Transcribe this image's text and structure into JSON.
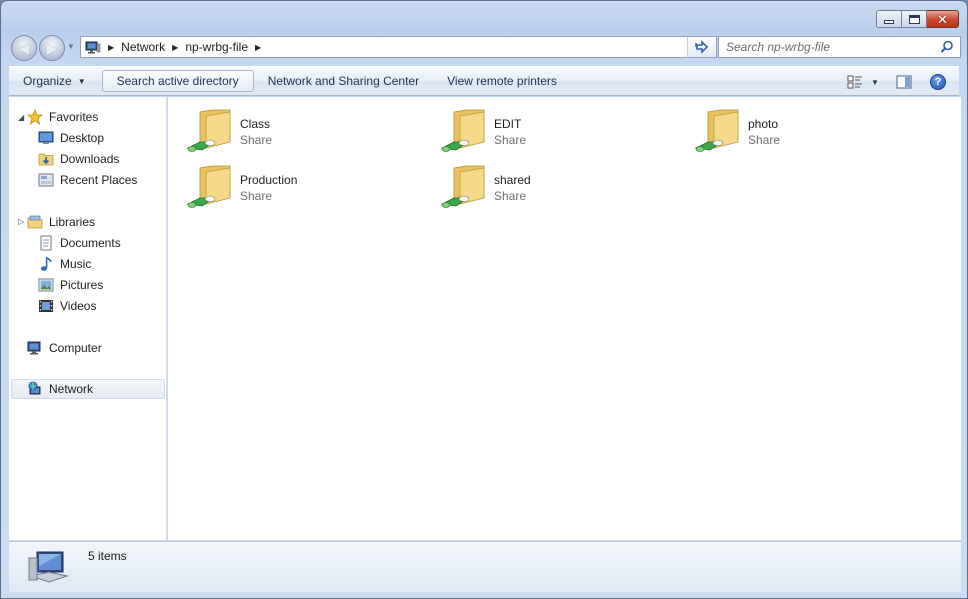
{
  "window": {
    "caption": {
      "minimize": "minimize",
      "maximize": "maximize",
      "close": "close"
    }
  },
  "navigation": {
    "back_icon": "back-arrow-icon",
    "forward_icon": "forward-arrow-icon",
    "breadcrumbs": [
      "Network",
      "np-wrbg-file"
    ],
    "search_placeholder": "Search np-wrbg-file"
  },
  "commandbar": {
    "organize": "Organize",
    "search_ad": "Search active directory",
    "network_sharing": "Network and Sharing Center",
    "remote_printers": "View remote printers"
  },
  "sidebar": {
    "favorites": {
      "label": "Favorites",
      "items": [
        "Desktop",
        "Downloads",
        "Recent Places"
      ]
    },
    "libraries": {
      "label": "Libraries",
      "items": [
        "Documents",
        "Music",
        "Pictures",
        "Videos"
      ]
    },
    "computer": "Computer",
    "network": "Network"
  },
  "files": [
    {
      "name": "Class",
      "type": "Share"
    },
    {
      "name": "EDIT",
      "type": "Share"
    },
    {
      "name": "photo",
      "type": "Share"
    },
    {
      "name": "Production",
      "type": "Share"
    },
    {
      "name": "shared",
      "type": "Share"
    }
  ],
  "status": {
    "text": "5 items"
  },
  "colors": {
    "accent": "#2c5ea8",
    "close_button": "#c8482d",
    "folder": "#f2d27a",
    "share_pipe": "#3aa84a"
  }
}
